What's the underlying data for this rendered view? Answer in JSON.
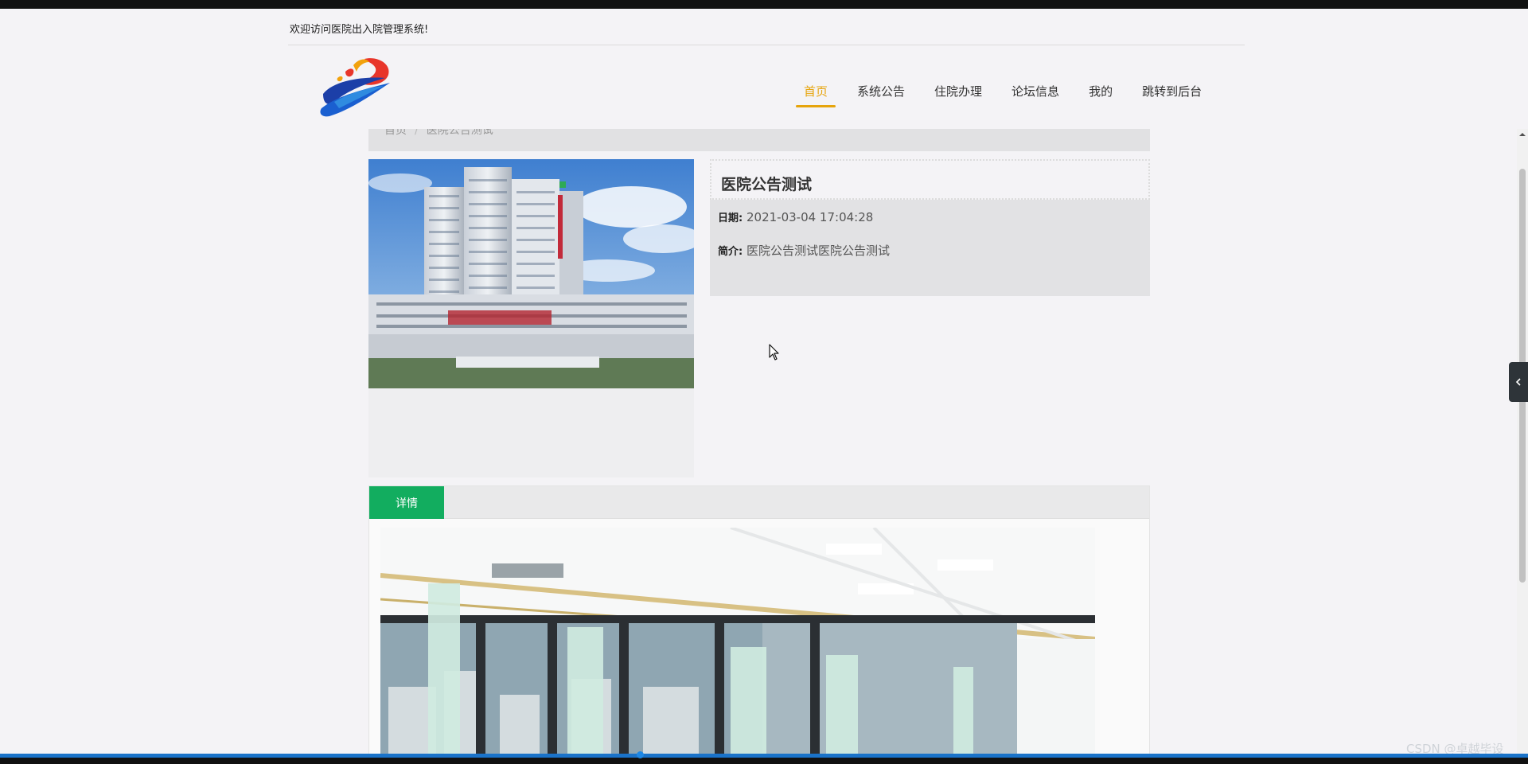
{
  "header": {
    "welcome_text": "欢迎访问医院出入院管理系统!"
  },
  "nav": {
    "items": [
      {
        "label": "首页",
        "active": true
      },
      {
        "label": "系统公告",
        "active": false
      },
      {
        "label": "住院办理",
        "active": false
      },
      {
        "label": "论坛信息",
        "active": false
      },
      {
        "label": "我的",
        "active": false
      },
      {
        "label": "跳转到后台",
        "active": false
      }
    ]
  },
  "breadcrumb": {
    "home": "首页",
    "separator": "/",
    "current": "医院公告测试"
  },
  "notice": {
    "title": "医院公告测试",
    "date_label": "日期:",
    "date_value": "2021-03-04 17:04:28",
    "intro_label": "简介:",
    "intro_value": "医院公告测试医院公告测试"
  },
  "detail": {
    "tab_label": "详情"
  },
  "watermark": "CSDN @卓越毕设",
  "colors": {
    "accent": "#e6a40c",
    "tab_green": "#12ad5f",
    "toggle_dark": "#2e3439"
  },
  "icons": {
    "side_toggle": "chevron-left-icon",
    "cursor": "mouse-pointer-icon"
  }
}
